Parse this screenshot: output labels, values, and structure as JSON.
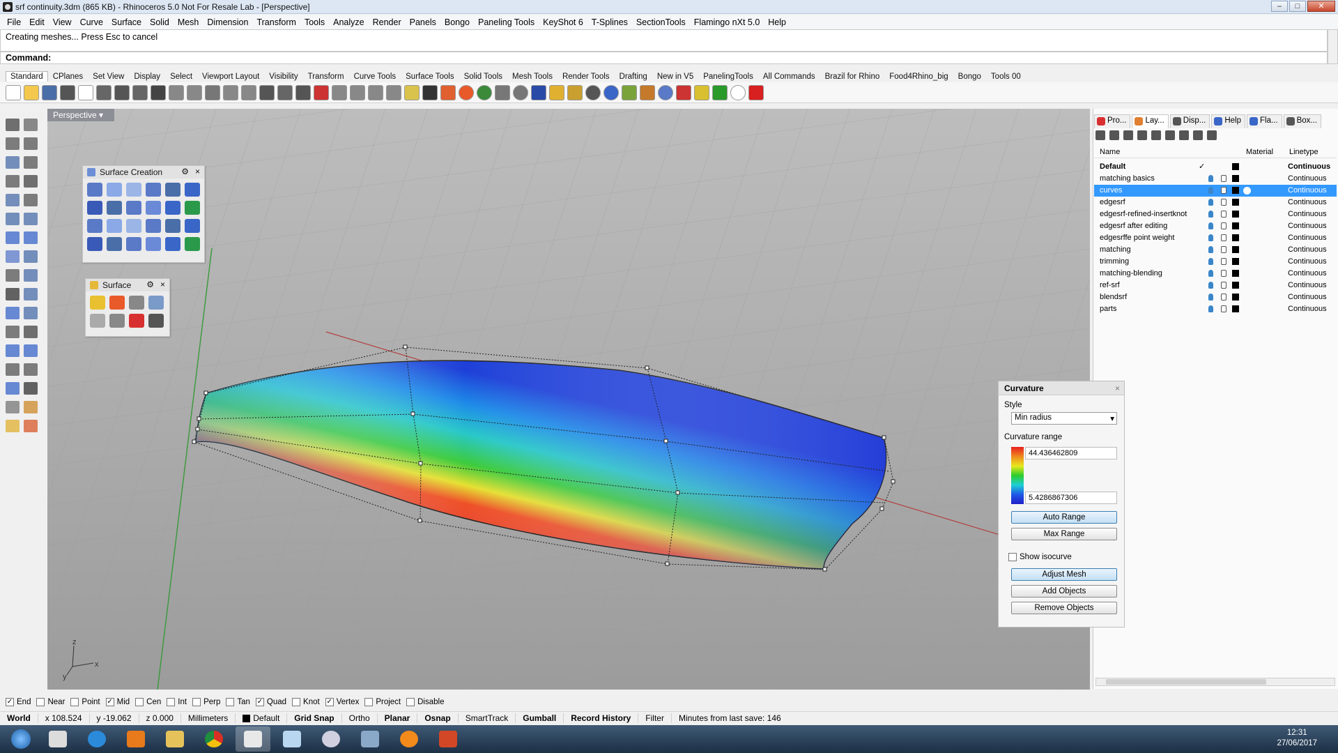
{
  "window": {
    "title": "srf continuity.3dm (865 KB) - Rhinoceros 5.0 Not For Resale Lab - [Perspective]"
  },
  "menu": [
    "File",
    "Edit",
    "View",
    "Curve",
    "Surface",
    "Solid",
    "Mesh",
    "Dimension",
    "Transform",
    "Tools",
    "Analyze",
    "Render",
    "Panels",
    "Bongo",
    "Paneling Tools",
    "KeyShot 6",
    "T-Splines",
    "SectionTools",
    "Flamingo nXt 5.0",
    "Help"
  ],
  "command": {
    "history": "Creating meshes... Press Esc to cancel",
    "prompt": "Command:"
  },
  "toolbar_tabs": [
    "Standard",
    "CPlanes",
    "Set View",
    "Display",
    "Select",
    "Viewport Layout",
    "Visibility",
    "Transform",
    "Curve Tools",
    "Surface Tools",
    "Solid Tools",
    "Mesh Tools",
    "Render Tools",
    "Drafting",
    "New in V5",
    "PanelingTools",
    "All Commands",
    "Brazil for Rhino",
    "Food4Rhino_big",
    "Bongo",
    "Tools 00"
  ],
  "viewport": {
    "title": "Perspective",
    "axis_labels": {
      "z": "z",
      "y": "y",
      "x": "x"
    }
  },
  "palettes": {
    "surface_creation": "Surface Creation",
    "surface": "Surface"
  },
  "right_panel": {
    "tabs": [
      "Pro...",
      "Lay...",
      "Disp...",
      "Help",
      "Fla...",
      "Box..."
    ],
    "columns": {
      "name": "Name",
      "material": "Material",
      "linetype": "Linetype"
    },
    "layers": [
      {
        "name": "Default",
        "linetype": "Continuous"
      },
      {
        "name": "matching basics",
        "linetype": "Continuous"
      },
      {
        "name": "curves",
        "linetype": "Continuous"
      },
      {
        "name": "edgesrf",
        "linetype": "Continuous"
      },
      {
        "name": "edgesrf-refined-insertknot",
        "linetype": "Continuous"
      },
      {
        "name": "edgesrf after editing",
        "linetype": "Continuous"
      },
      {
        "name": "edgesrffe point weight",
        "linetype": "Continuous"
      },
      {
        "name": "matching",
        "linetype": "Continuous"
      },
      {
        "name": "trimming",
        "linetype": "Continuous"
      },
      {
        "name": "matching-blending",
        "linetype": "Continuous"
      },
      {
        "name": "ref-srf",
        "linetype": "Continuous"
      },
      {
        "name": "blendsrf",
        "linetype": "Continuous"
      },
      {
        "name": "parts",
        "linetype": "Continuous"
      }
    ],
    "selected_layer": "curves"
  },
  "curvature": {
    "title": "Curvature",
    "style_label": "Style",
    "style_value": "Min radius",
    "range_label": "Curvature range",
    "max": "44.436462809",
    "min": "5.4286867306",
    "auto_range": "Auto Range",
    "max_range": "Max Range",
    "show_isocurve": "Show isocurve",
    "adjust_mesh": "Adjust Mesh",
    "add_objects": "Add Objects",
    "remove_objects": "Remove Objects"
  },
  "osnap": [
    {
      "label": "End",
      "checked": true
    },
    {
      "label": "Near",
      "checked": false
    },
    {
      "label": "Point",
      "checked": false
    },
    {
      "label": "Mid",
      "checked": true
    },
    {
      "label": "Cen",
      "checked": false
    },
    {
      "label": "Int",
      "checked": false
    },
    {
      "label": "Perp",
      "checked": false
    },
    {
      "label": "Tan",
      "checked": false
    },
    {
      "label": "Quad",
      "checked": true
    },
    {
      "label": "Knot",
      "checked": false
    },
    {
      "label": "Vertex",
      "checked": true
    },
    {
      "label": "Project",
      "checked": false
    },
    {
      "label": "Disable",
      "checked": false
    }
  ],
  "status": {
    "cplane": "World",
    "x": "x 108.524",
    "y": "y -19.062",
    "z": "z 0.000",
    "units": "Millimeters",
    "layer": "Default",
    "grid_snap": "Grid Snap",
    "ortho": "Ortho",
    "planar": "Planar",
    "osnap": "Osnap",
    "smarttrack": "SmartTrack",
    "gumball": "Gumball",
    "record_history": "Record History",
    "filter": "Filter",
    "save_info": "Minutes from last save: 146"
  },
  "taskbar": {
    "time": "12:31",
    "date": "27/06/2017"
  },
  "colors": {
    "accent": "#3399ff",
    "viewport_bg": "#a9a9a9"
  }
}
